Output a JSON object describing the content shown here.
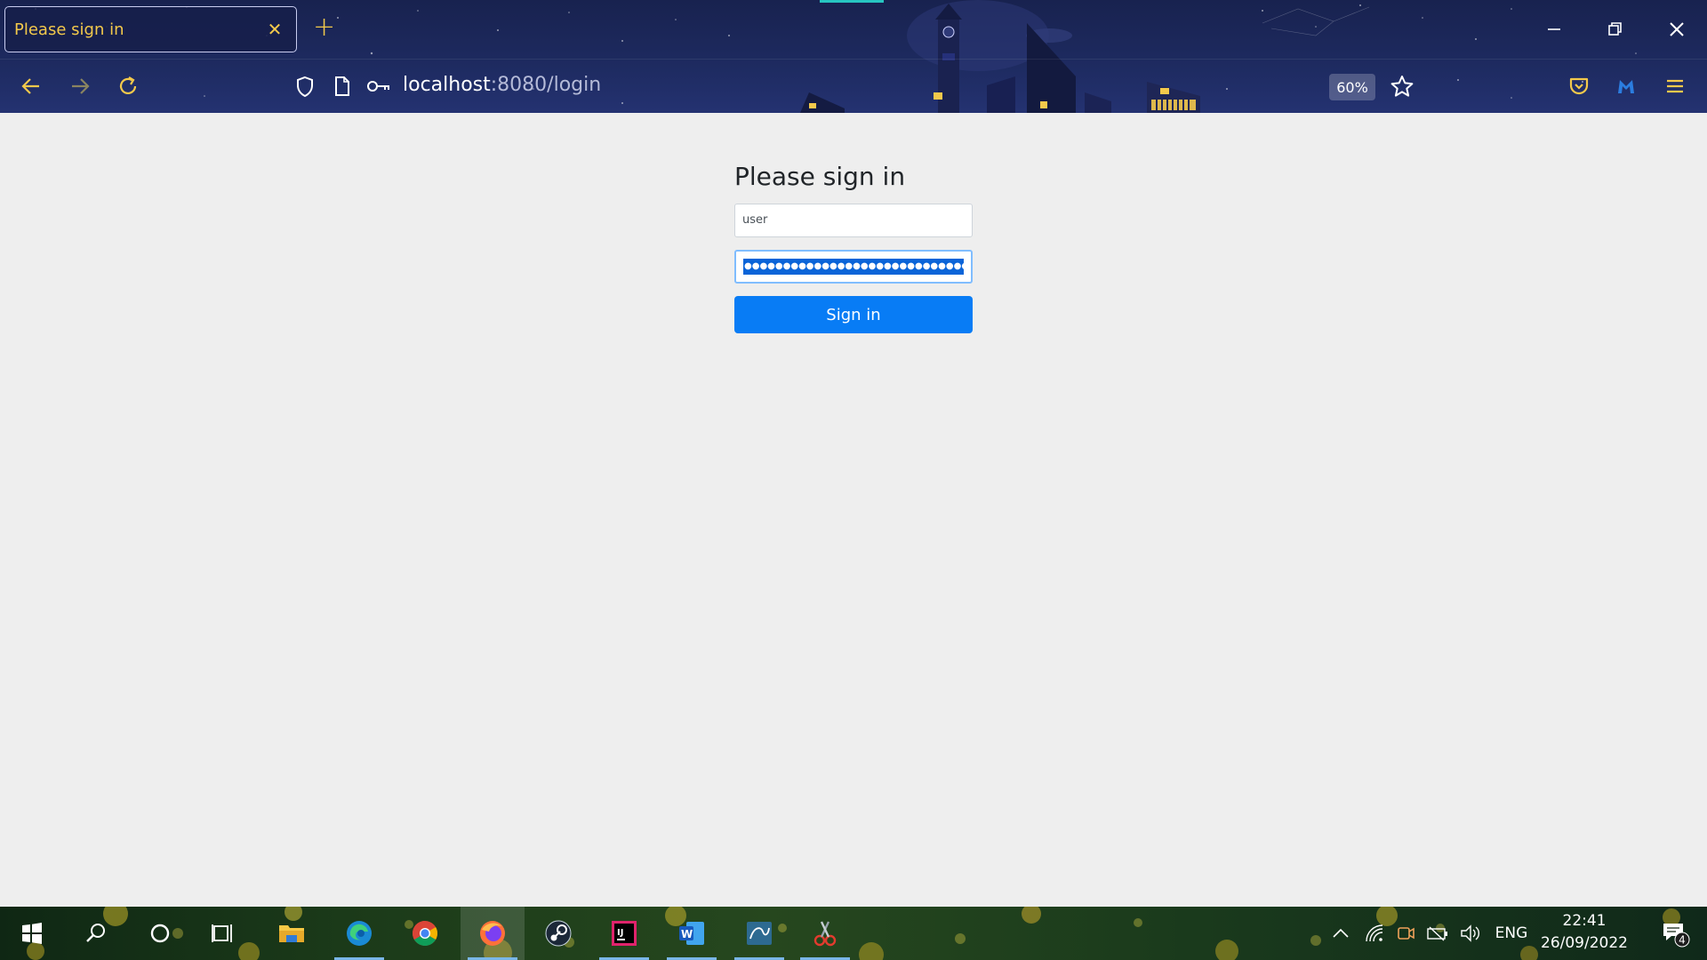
{
  "tabs": [
    {
      "title": "Please sign in"
    }
  ],
  "address_bar": {
    "host": "localhost",
    "rest": ":8080/login"
  },
  "zoom_level": "60%",
  "signin": {
    "heading": "Please sign in",
    "username_value": "user",
    "password_mask": "●●●●●●●●●●●●●●●●●●●●●●●●●●●●●●●",
    "button_label": "Sign in"
  },
  "taskbar": {
    "apps": [
      "start-icon",
      "search-icon",
      "cortana-icon",
      "task-view-icon",
      "file-explorer-icon",
      "edge-icon",
      "chrome-icon",
      "firefox-icon",
      "steam-icon",
      "intellij-icon",
      "word-icon",
      "mysql-workbench-icon",
      "snipping-tool-icon"
    ],
    "language": "ENG",
    "time": "22:41",
    "date": "26/09/2022",
    "notification_count": "4"
  },
  "colors": {
    "accent_tab_text": "#f3c94b",
    "button_primary": "#087cf5",
    "page_background": "#eeeeee"
  }
}
